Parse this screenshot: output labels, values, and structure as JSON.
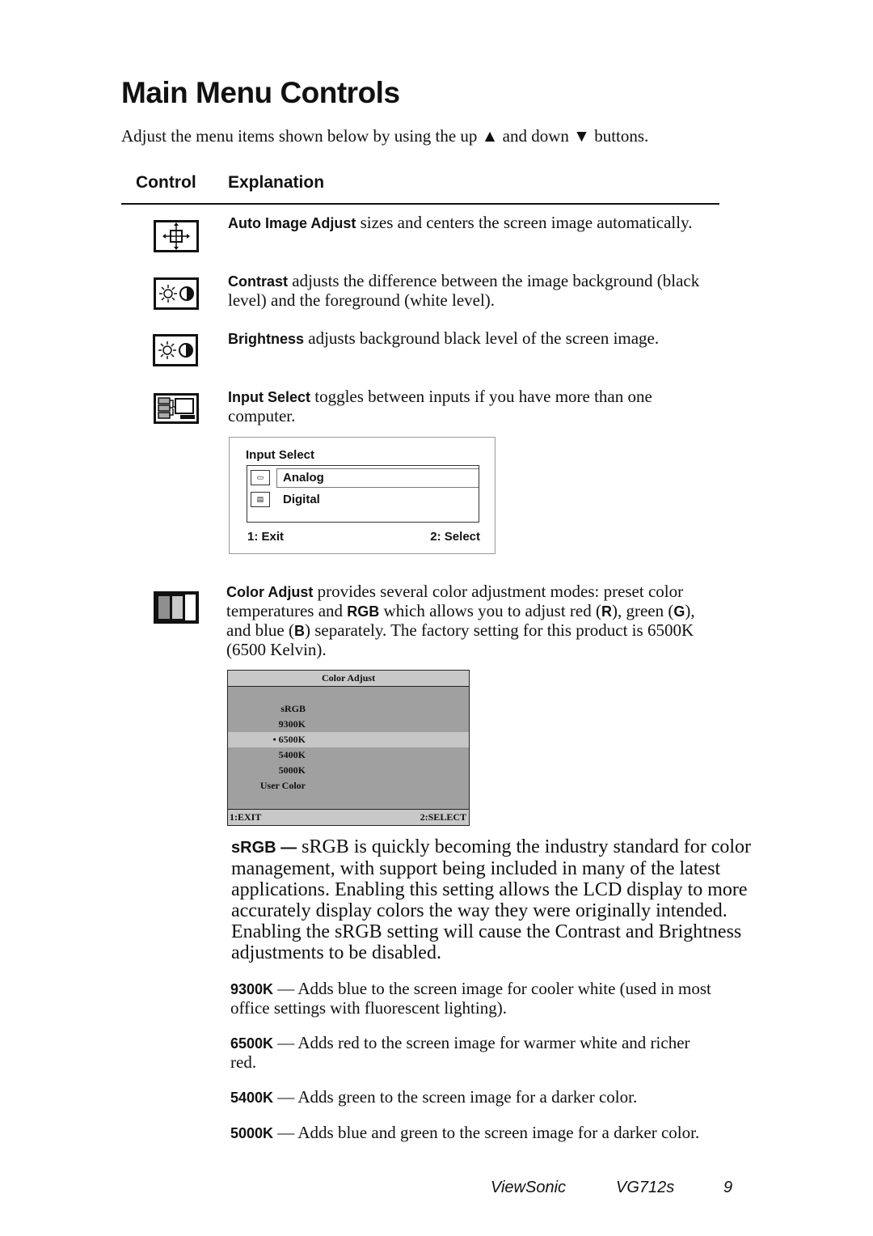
{
  "page": {
    "title": "Main Menu Controls",
    "intro": "Adjust the menu items shown below by using the up ▲ and down ▼ buttons.",
    "table_headers": {
      "control": "Control",
      "explanation": "Explanation"
    }
  },
  "controls": [
    {
      "icon": "auto-image-adjust-icon",
      "term": "Auto Image Adjust",
      "text": " sizes and centers the screen image automatically."
    },
    {
      "icon": "contrast-icon",
      "term": "Contrast",
      "text": " adjusts the difference between the image background (black level) and the foreground (white level)."
    },
    {
      "icon": "brightness-icon",
      "term": "Brightness",
      "text": " adjusts background black level of the screen image."
    },
    {
      "icon": "input-select-icon",
      "term": "Input Select",
      "text": " toggles between inputs if you have more than one computer."
    },
    {
      "icon": "color-adjust-icon",
      "term": "Color Adjust",
      "text_before": " provides several color adjustment modes: preset color temperatures and ",
      "rgb": "RGB",
      "text_mid": " which allows you to adjust red (",
      "r": "R",
      "text_mid2": "), green (",
      "g": "G",
      "text_mid3": "), and blue (",
      "b": "B",
      "text_after": ") separately. The factory setting for this product is 6500K (6500 Kelvin)."
    }
  ],
  "input_select_osd": {
    "title": "Input Select",
    "options": [
      {
        "icon": "analog-icon",
        "label": "Analog",
        "selected": true
      },
      {
        "icon": "digital-icon",
        "label": "Digital",
        "selected": false
      }
    ],
    "footer_left": "1: Exit",
    "footer_right": "2: Select"
  },
  "color_adjust_osd": {
    "title": "Color Adjust",
    "options": [
      "sRGB",
      "9300K",
      "• 6500K",
      "5400K",
      "5000K",
      "User Color"
    ],
    "selected_index": 2,
    "footer_left": "1:EXIT",
    "footer_right": "2:SELECT"
  },
  "modes": [
    {
      "term": "sRGB —",
      "text": " sRGB is quickly becoming the industry standard for color management, with support being included in many of the latest applications. Enabling this setting allows the LCD display to more accurately display colors the way they were originally intended. Enabling the sRGB setting will cause the Contrast and Brightness adjustments to be disabled."
    },
    {
      "term": "9300K",
      "text": " — Adds blue to the screen image for cooler white (used in most office settings with fluorescent lighting)."
    },
    {
      "term": "6500K",
      "text": " — Adds red to the screen image for warmer white and richer red."
    },
    {
      "term": "5400K",
      "text": " — Adds green to the screen image for a darker color."
    },
    {
      "term": "5000K",
      "text": " — Adds blue and green to the screen image for a darker color."
    }
  ],
  "footer": {
    "brand": "ViewSonic",
    "model": "VG712s",
    "page_number": "9"
  }
}
